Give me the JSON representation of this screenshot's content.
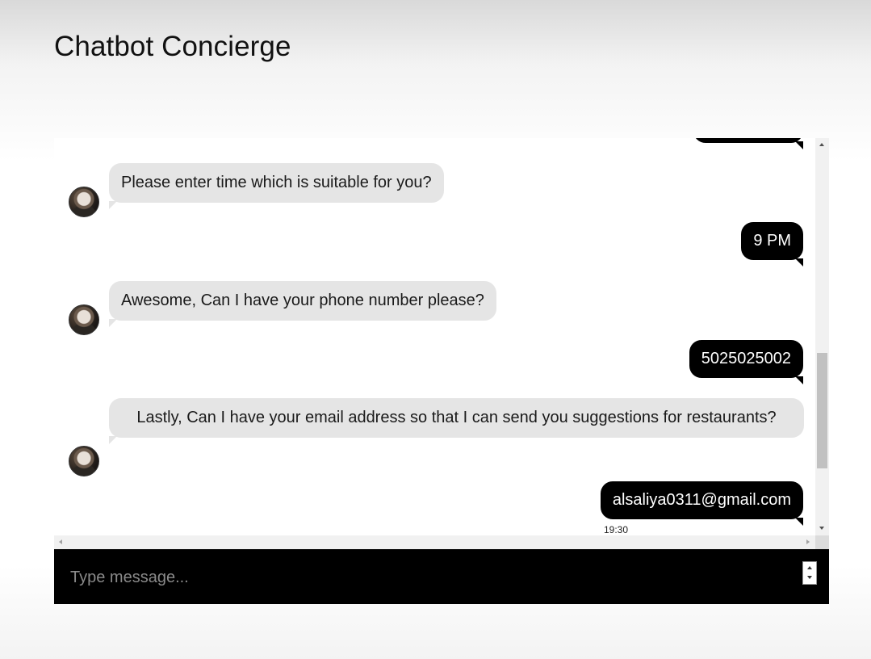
{
  "header": {
    "title": "Chatbot Concierge"
  },
  "messages": [
    {
      "sender": "bot",
      "text": "Please enter time which is suitable for you?"
    },
    {
      "sender": "user",
      "text": "9 PM"
    },
    {
      "sender": "bot",
      "text": "Awesome, Can I have your phone number please?"
    },
    {
      "sender": "user",
      "text": "5025025002"
    },
    {
      "sender": "bot",
      "text": "Lastly, Can I have your email address so that I can send you suggestions for restaurants?"
    },
    {
      "sender": "user",
      "text": "alsaliya0311@gmail.com"
    }
  ],
  "last_message_time": "19:30",
  "composer": {
    "placeholder": "Type message..."
  },
  "icons": {
    "avatar": "bot-avatar-icon"
  },
  "colors": {
    "user_bubble": "#000000",
    "bot_bubble": "#e5e5e5",
    "input_bar": "#000000"
  }
}
